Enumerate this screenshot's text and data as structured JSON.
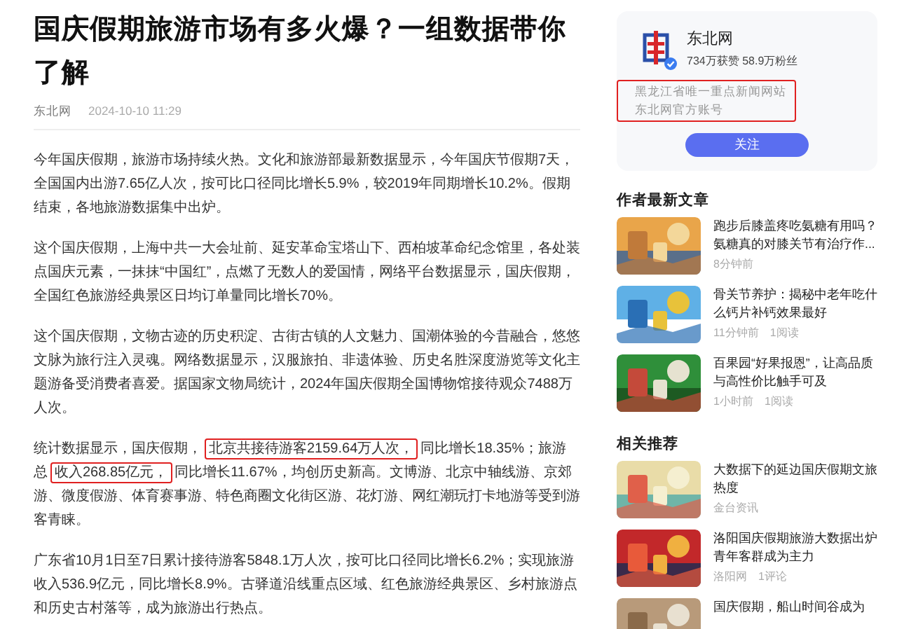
{
  "article": {
    "title": "国庆假期旅游市场有多火爆？一组数据带你了解",
    "source": "东北网",
    "date": "2024-10-10 11:29",
    "paragraphs": [
      [
        {
          "text": "今年国庆假期，旅游市场持续火热。文化和旅游部最新数据显示，今年国庆节假期7天，全国国内出游7.65亿人次，按可比口径同比增长5.9%，较2019年同期增长10.2%。假期结束，各地旅游数据集中出炉。",
          "highlighted": false
        }
      ],
      [
        {
          "text": "这个国庆假期，上海中共一大会址前、延安革命宝塔山下、西柏坡革命纪念馆里，各处装点国庆元素，一抹抹“中国红”，点燃了无数人的爱国情，网络平台数据显示，国庆假期，全国红色旅游经典景区日均订单量同比增长70%。",
          "highlighted": false
        }
      ],
      [
        {
          "text": "这个国庆假期，文物古迹的历史积淀、古街古镇的人文魅力、国潮体验的今昔融合，悠悠文脉为旅行注入灵魂。网络数据显示，汉服旅拍、非遗体验、历史名胜深度游览等文化主题游备受消费者喜爱。据国家文物局统计，2024年国庆假期全国博物馆接待观众7488万人次。",
          "highlighted": false
        }
      ],
      [
        {
          "text": "统计数据显示，国庆假期，",
          "highlighted": false
        },
        {
          "text": "北京共接待游客2159.64万人次，",
          "highlighted": true
        },
        {
          "text": "同比增长18.35%；旅游总",
          "highlighted": false
        },
        {
          "text": "收入268.85亿元，",
          "highlighted": true
        },
        {
          "text": "同比增长11.67%，均创历史新高。文博游、北京中轴线游、京郊游、微度假游、体育赛事游、特色商圈文化街区游、花灯游、网红潮玩打卡地游等受到游客青睐。",
          "highlighted": false
        }
      ],
      [
        {
          "text": "广东省10月1日至7日累计接待游客5848.1万人次，按可比口径同比增长6.2%；实现旅游收入536.9亿元，同比增长8.9%。古驿道沿线重点区域、红色旅游经典景区、乡村旅游点和历史古村落等，成为旅游出行热点。",
          "highlighted": false
        }
      ]
    ]
  },
  "author": {
    "name": "东北网",
    "stats": "734万获赞 58.9万粉丝",
    "verified": true,
    "description": [
      {
        "text": "黑龙江省唯一重点新闻网站"
      },
      {
        "text": "东北网官方账号"
      }
    ],
    "description_highlighted": true,
    "follow_button": "关注"
  },
  "latest": {
    "heading": "作者最新文章",
    "items": [
      {
        "title": "跑步后膝盖疼吃氨糖有用吗？氨糖真的对膝关节有治疗作...",
        "meta": [
          "8分钟前"
        ]
      },
      {
        "title": "骨关节养护：揭秘中老年吃什么钙片补钙效果最好",
        "meta": [
          "11分钟前",
          "1阅读"
        ]
      },
      {
        "title": "百果园“好果报恩”，让高品质与高性价比触手可及",
        "meta": [
          "1小时前",
          "1阅读"
        ]
      }
    ]
  },
  "related": {
    "heading": "相关推荐",
    "items": [
      {
        "title": "大数据下的延边国庆假期文旅热度",
        "meta": [
          "金台资讯"
        ]
      },
      {
        "title": "洛阳国庆假期旅游大数据出炉青年客群成为主力",
        "meta": [
          "洛阳网",
          "1评论"
        ]
      },
      {
        "title": "国庆假期，船山时间谷成为"
      }
    ]
  }
}
